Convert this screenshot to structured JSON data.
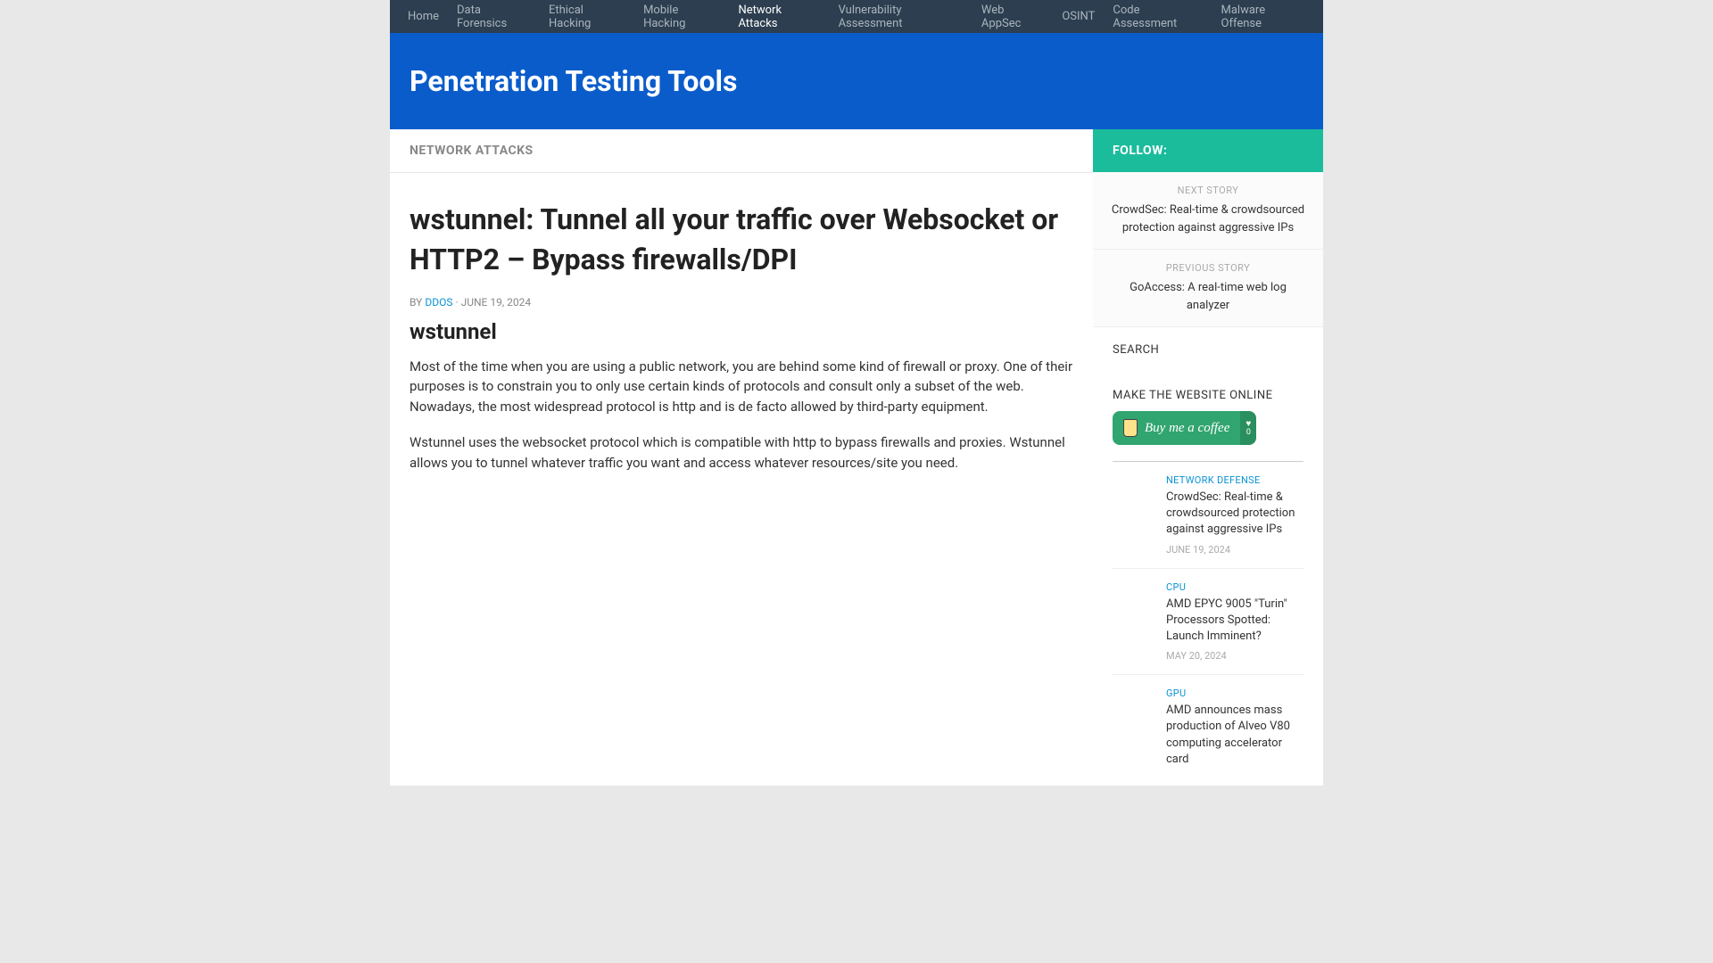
{
  "nav": {
    "items": [
      {
        "label": "Home",
        "active": false
      },
      {
        "label": "Data Forensics",
        "active": false
      },
      {
        "label": "Ethical Hacking",
        "active": false
      },
      {
        "label": "Mobile Hacking",
        "active": false
      },
      {
        "label": "Network Attacks",
        "active": true
      },
      {
        "label": "Vulnerability Assessment",
        "active": false
      },
      {
        "label": "Web AppSec",
        "active": false
      },
      {
        "label": "OSINT",
        "active": false
      },
      {
        "label": "Code Assessment",
        "active": false
      },
      {
        "label": "Malware Offense",
        "active": false
      }
    ]
  },
  "header": {
    "title": "Penetration Testing Tools"
  },
  "category": {
    "label": "NETWORK ATTACKS"
  },
  "article": {
    "title": "wstunnel: Tunnel all your traffic over Websocket or HTTP2 – Bypass firewalls/DPI",
    "meta_by": "BY ",
    "author": "DDOS",
    "meta_sep": " · ",
    "date": "JUNE 19, 2024",
    "subtitle": "wstunnel",
    "para1": "Most of the time when you are using a public network, you are behind some kind of firewall or proxy. One of their purposes is to constrain you to only use certain kinds of protocols and consult only a subset of the web. Nowadays, the most widespread protocol is http and is de facto allowed by third-party equipment.",
    "para2": "Wstunnel uses the websocket protocol which is compatible with http to bypass firewalls and proxies. Wstunnel allows you to tunnel whatever traffic you want and access whatever resources/site you need."
  },
  "sidebar": {
    "follow_label": "FOLLOW:",
    "next_label": "NEXT STORY",
    "next_title": "CrowdSec: Real-time & crowdsourced protection against aggressive IPs",
    "prev_label": "PREVIOUS STORY",
    "prev_title": "GoAccess: A real-time web log analyzer",
    "search_heading": "SEARCH",
    "donate_heading": "MAKE THE WEBSITE ONLINE",
    "bmc_text": "Buy me a coffee",
    "bmc_count": "0",
    "posts": [
      {
        "category": "NETWORK DEFENSE",
        "title": "CrowdSec: Real-time & crowdsourced protection against aggressive IPs",
        "date": "JUNE 19, 2024"
      },
      {
        "category": "CPU",
        "title": "AMD EPYC 9005 \"Turin\" Processors Spotted: Launch Imminent?",
        "date": "MAY 20, 2024"
      },
      {
        "category": "GPU",
        "title": "AMD announces mass production of Alveo V80 computing accelerator card",
        "date": ""
      }
    ]
  }
}
